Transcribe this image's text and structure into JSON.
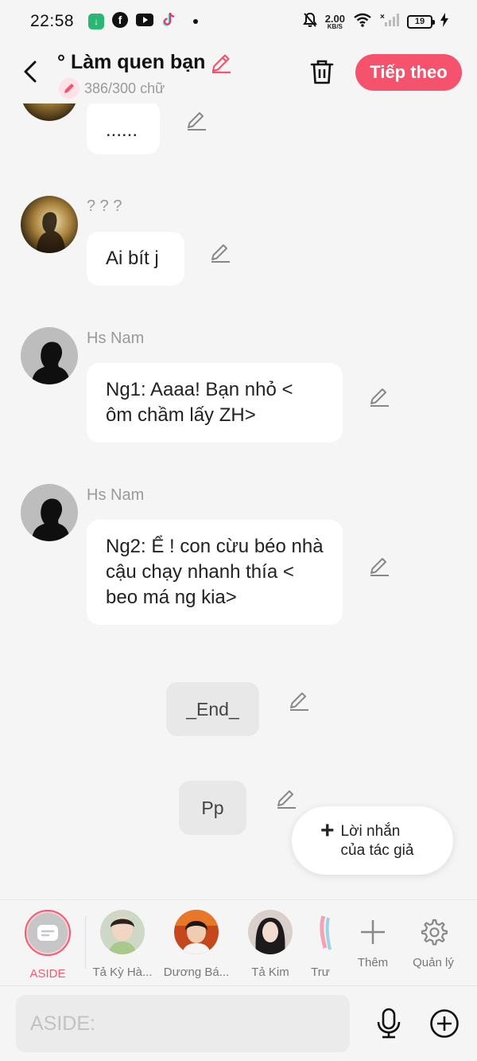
{
  "status_bar": {
    "time": "22:58",
    "net_speed_value": "2.00",
    "net_speed_unit": "KB/S",
    "battery": "19"
  },
  "header": {
    "title": "° Làm quen bạn",
    "counter": "386/300 chữ",
    "next_label": "Tiếp theo",
    "accent_color": "#f4526d"
  },
  "messages": [
    {
      "sender": "",
      "text": "......"
    },
    {
      "sender": "? ? ?",
      "text": "Ai bít j"
    },
    {
      "sender": "Hs Nam",
      "text": "Ng1: Aaaa! Bạn nhỏ < ôm chầm lấy ZH>"
    },
    {
      "sender": "Hs Nam",
      "text": "Ng2: Ể ! con cừu béo nhà cậu chạy nhanh thía < beo má ng kia>"
    }
  ],
  "narrations": [
    "_End_",
    "Pp"
  ],
  "author_note": {
    "line1": "Lời nhắn",
    "line2": "của tác giả"
  },
  "characters": [
    {
      "name": "ASIDE"
    },
    {
      "name": "Tả Kỳ Hà..."
    },
    {
      "name": "Dương Bá..."
    },
    {
      "name": "Tả Kim"
    },
    {
      "name": "Trư"
    }
  ],
  "actions": {
    "add_label": "Thêm",
    "manage_label": "Quản lý"
  },
  "input": {
    "placeholder": "ASIDE:"
  }
}
